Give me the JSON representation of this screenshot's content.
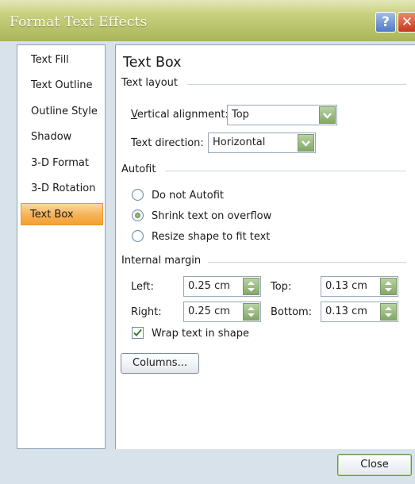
{
  "window": {
    "title": "Format Text Effects"
  },
  "nav": {
    "items": [
      {
        "label": "Text Fill"
      },
      {
        "label": "Text Outline"
      },
      {
        "label": "Outline Style"
      },
      {
        "label": "Shadow"
      },
      {
        "label": "3-D Format"
      },
      {
        "label": "3-D Rotation"
      },
      {
        "label": "Text Box",
        "selected": true
      }
    ]
  },
  "panel": {
    "heading": "Text Box",
    "text_layout": {
      "section": "Text layout",
      "vertical_alignment_label": "Vertical alignment:",
      "vertical_alignment_value": "Top",
      "text_direction_label": "Text direction:",
      "text_direction_value": "Horizontal"
    },
    "autofit": {
      "section": "Autofit",
      "options": [
        {
          "label": "Do not Autofit",
          "selected": false
        },
        {
          "label": "Shrink text on overflow",
          "selected": true
        },
        {
          "label": "Resize shape to fit text",
          "selected": false
        }
      ]
    },
    "internal_margin": {
      "section": "Internal margin",
      "left_label": "Left:",
      "left_value": "0.25 cm",
      "right_label": "Right:",
      "right_value": "0.25 cm",
      "top_label": "Top:",
      "top_value": "0.13 cm",
      "bottom_label": "Bottom:",
      "bottom_value": "0.13 cm"
    },
    "wrap_text": {
      "label": "Wrap text in shape",
      "checked": true
    },
    "columns_button": "Columns..."
  },
  "footer": {
    "close_label": "Close"
  },
  "colors": {
    "titlebar": "#b6c068",
    "selection": "#f7b55b",
    "accent_green": "#82a867"
  }
}
